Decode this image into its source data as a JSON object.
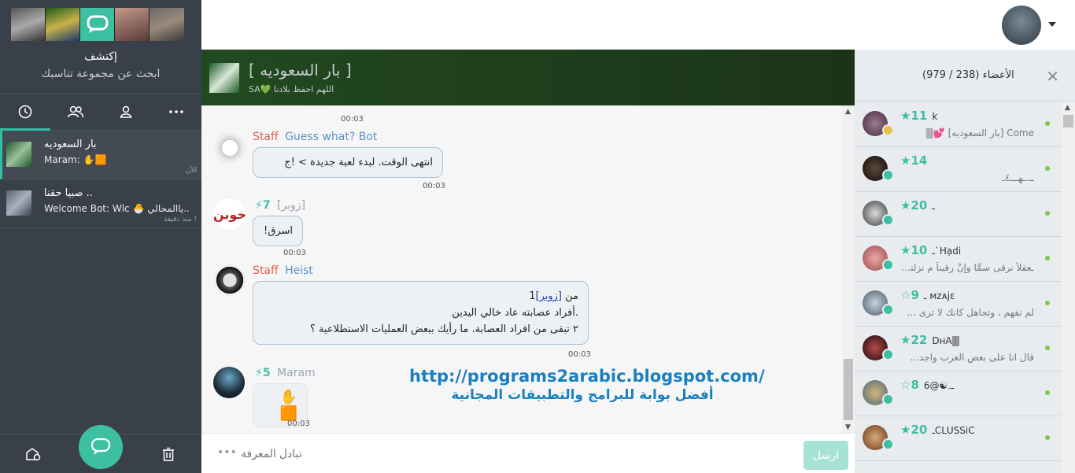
{
  "sidebar": {
    "discover_title": "إكتشف",
    "discover_subtitle": "ابحث عن مجموعة تناسبك",
    "tabs": [
      "recent-icon",
      "groups-icon",
      "profile-icon",
      "more-icon"
    ],
    "conversations": [
      {
        "name": "بار السعوديه",
        "preview": "Maram: ✋🟧",
        "time": "الآن"
      },
      {
        "name": "صبيا حقنا ..",
        "preview": "Welcome Bot: Wlc 🐣 ياالمحالي..",
        "time": "منذ دقيقة !"
      }
    ]
  },
  "chat": {
    "room_title": "[ بار السعوديه ]",
    "room_subtitle": "SA💚 اللهم احفظ بلادنا",
    "top_timestamp": "00:03",
    "messages": [
      {
        "role": "Staff",
        "sender": "Guess what? Bot",
        "text": "انتهى الوقت. لبدء لعبة جديدة > !ج",
        "time": "00:03"
      },
      {
        "level": "7",
        "sender": "[زوبر]",
        "text": "اسرق!",
        "time": "00:03"
      },
      {
        "role": "Staff",
        "sender": "Heist",
        "line1_prefix": "من",
        "line1_link": "[زوبر]",
        "line1_suffix": "1",
        "line2": ".أفراد عصابته عاد خالي اليدين",
        "line3": "٢ تبقى من افراد العصابة. ما رأيك ببعض العمليات الاستطلاعية ؟",
        "time": "00:03"
      },
      {
        "level": "5",
        "sender": "Maram",
        "text": "✋🟧",
        "time": "00:03"
      }
    ],
    "compose_placeholder": "تبادل المعرفة",
    "send_label": "ارسل"
  },
  "watermark": {
    "url": "http://programs2arabic.blogspot.com/",
    "tagline": "أفضل بوابة للبرامج والتطبيقات المجانية"
  },
  "members": {
    "count_label": "الأعضاء (238 / 979)",
    "list": [
      {
        "level": "★11",
        "name": "k",
        "status": "Come [بار السعوديه] 💕🀫",
        "color": "#6a4b5e"
      },
      {
        "level": "★14",
        "name": "",
        "status": "ــ.ـهـــ٤ـ",
        "color": "#2b2323"
      },
      {
        "level": "★20",
        "name": "ـ",
        "status": "",
        "color": "#7d7d7d"
      },
      {
        "level": "★10",
        "name": "ـ`Hạdi",
        "status": "ـعقلاً نرقى سمَّا وإنْ رقيناً م نزلنا...",
        "color": "#c97a7a"
      },
      {
        "level": "☆9",
        "name": "ـ ᴍzᴀjɛ",
        "status": "لم تفهم ، وتجاهل كانك لا ترى ...",
        "color": "#8f9aa5"
      },
      {
        "level": "★22",
        "name": "DʜA🀫",
        "status": "قال انا على بعض العرب واجد...",
        "color": "#5a1e1e"
      },
      {
        "level": "☆8",
        "name": "ـﮧ☯@6",
        "status": "",
        "color": "#b08a4a"
      },
      {
        "level": "★20",
        "name": "ـCLᑌSSiC",
        "status": "",
        "color": "#8a5a3a"
      }
    ]
  },
  "colors": {
    "accent": "#3dbfa2",
    "sidebar_bg": "#394049",
    "header_green": "#224a20",
    "staff_red": "#e05b4b",
    "user_blue": "#5b8fc9"
  }
}
